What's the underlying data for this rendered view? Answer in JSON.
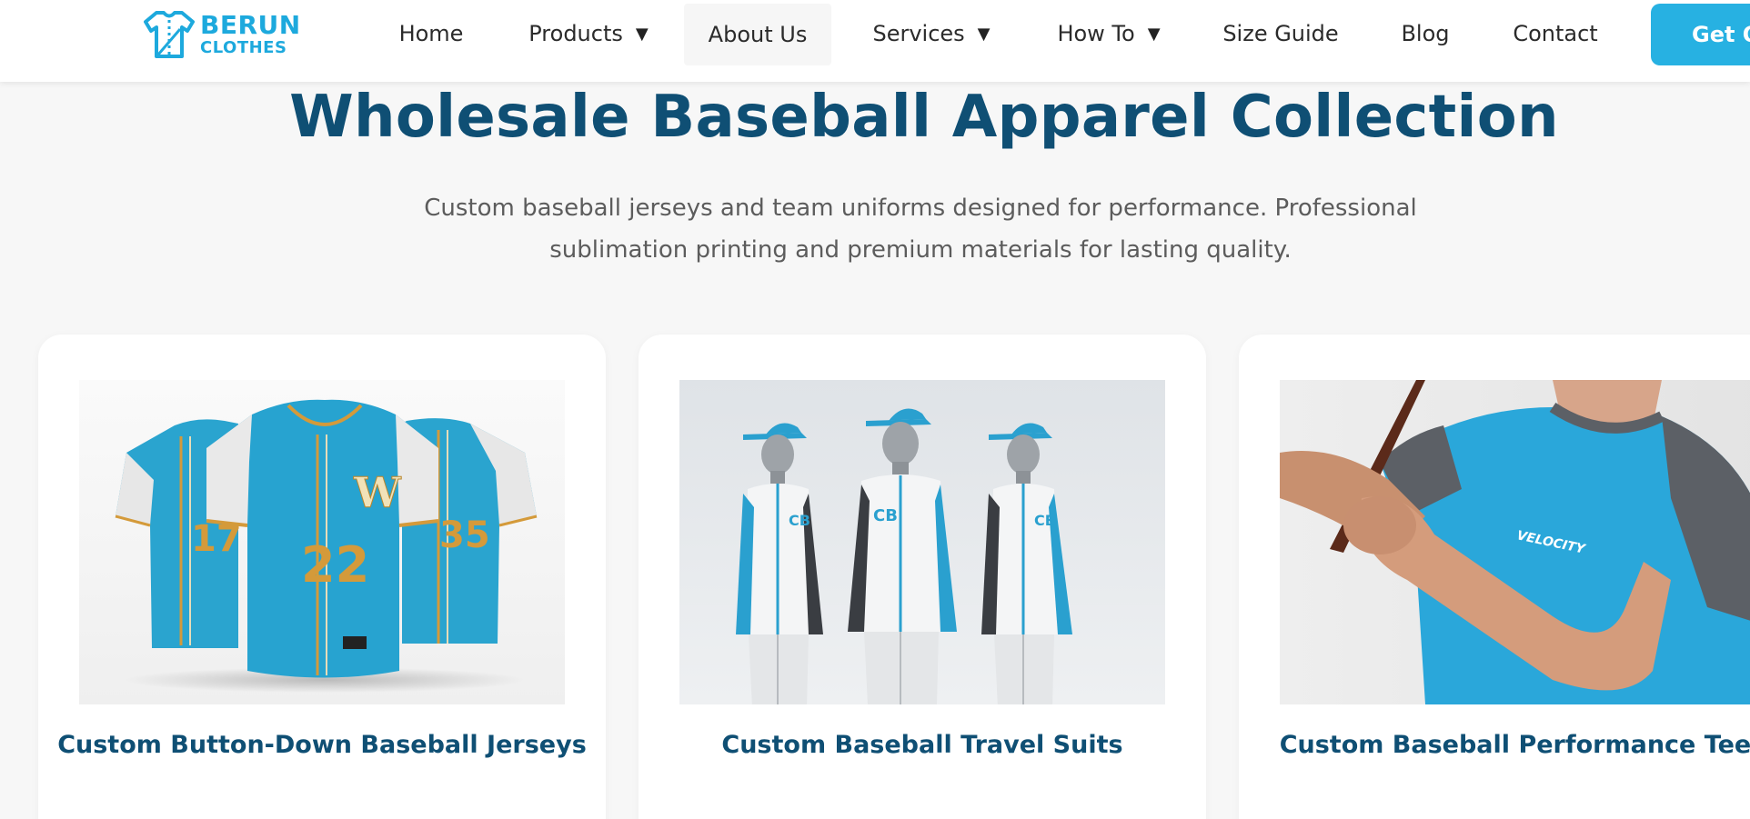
{
  "brand": {
    "line1": "BERUN",
    "line2": "CLOTHES",
    "icon": "shirt-logo-icon",
    "color": "#1da9dd"
  },
  "nav": {
    "items": [
      {
        "label": "Home",
        "has_dropdown": false
      },
      {
        "label": "Products",
        "has_dropdown": true,
        "caret": "▼"
      },
      {
        "label": "About Us",
        "has_dropdown": false
      },
      {
        "label": "Services",
        "has_dropdown": true,
        "caret": "▼"
      },
      {
        "label": "How To",
        "has_dropdown": true,
        "caret": "▼"
      },
      {
        "label": "Size Guide",
        "has_dropdown": false
      },
      {
        "label": "Blog",
        "has_dropdown": false
      },
      {
        "label": "Contact",
        "has_dropdown": false
      }
    ],
    "cta_label": "Get Q"
  },
  "hero": {
    "title": "Wholesale Baseball Apparel Collection",
    "subtitle": "Custom baseball jerseys and team uniforms designed for performance. Professional sublimation printing and premium materials for lasting quality."
  },
  "products": [
    {
      "title": "Custom Button-Down Baseball Jerseys",
      "image": "baseball-jerseys-photo",
      "numbers": [
        "17",
        "22",
        "35"
      ],
      "crest": "W"
    },
    {
      "title": "Custom Baseball Travel Suits",
      "image": "travel-suits-photo",
      "crest": "CB"
    },
    {
      "title": "Custom Baseball Performance Tees",
      "image": "performance-tee-photo",
      "shirt_text": "VELOCITY"
    }
  ],
  "colors": {
    "heading": "#0f4f74",
    "accent": "#27b1e2",
    "jersey": "#2aa4cf",
    "gold": "#d49a3a"
  }
}
